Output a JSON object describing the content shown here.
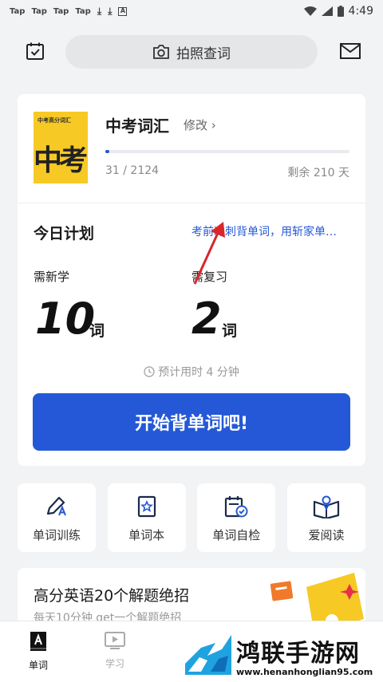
{
  "status_bar": {
    "tap_labels": [
      "Tap",
      "Tap",
      "Tap",
      "Tap"
    ],
    "time": "4:49"
  },
  "header": {
    "search_label": "拍照查词"
  },
  "book": {
    "cover_title": "中考高分词汇",
    "cover_big": "中考",
    "title": "中考词汇",
    "edit_label": "修改 ›",
    "progress_text": "31 / 2124",
    "progress_fraction": 0.0146,
    "days_left": "剩余 210 天"
  },
  "plan": {
    "title": "今日计划",
    "tip": "考前冲刺背单词，用斩家单…",
    "new_label": "需新学",
    "new_count": "10",
    "new_unit": "词",
    "review_label": "需复习",
    "review_count": "2",
    "review_unit": "词",
    "estimate": "预计用时 4 分钟",
    "start_button": "开始背单词吧!"
  },
  "tiles": [
    {
      "label": "单词训练",
      "icon": "pencil-icon"
    },
    {
      "label": "单词本",
      "icon": "notebook-icon"
    },
    {
      "label": "单词自检",
      "icon": "calendar-check-icon"
    },
    {
      "label": "爱阅读",
      "icon": "open-book-icon"
    }
  ],
  "promo": {
    "title": "高分英语20个解题绝招",
    "subtitle": "每天10分钟 get一个解题绝招"
  },
  "tabbar": {
    "tabs": [
      {
        "label": "单词",
        "active": true
      },
      {
        "label": "学习",
        "active": false
      }
    ]
  },
  "watermark": {
    "name": "鸿联手游网",
    "url": "www.henanhonglian95.com"
  },
  "colors": {
    "accent": "#2458d6",
    "book_cover": "#f6c925",
    "arrow": "#d9262b"
  }
}
